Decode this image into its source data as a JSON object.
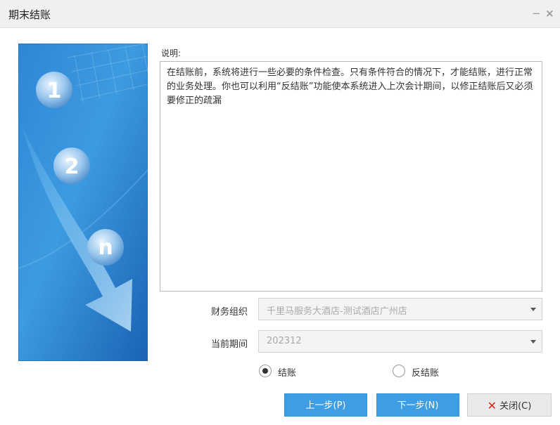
{
  "window": {
    "title": "期末结账",
    "minimize_glyph": "−",
    "close_glyph": "×"
  },
  "wizard_graphic": {
    "step_labels": [
      "1",
      "2",
      "n"
    ],
    "icon": "wizard-steps-illustration",
    "colors": {
      "blue_dark": "#1f6fbf",
      "blue_light": "#4aa6e2"
    }
  },
  "description": {
    "label": "说明:",
    "text": "在结账前，系统将进行一些必要的条件检查。只有条件符合的情况下，才能结账，进行正常的业务处理。你也可以利用“反结账”功能使本系统进入上次会计期间，以修正结账后又必须要修正的疏漏"
  },
  "fields": {
    "org_label": "财务组织",
    "org_value": "千里马服务大酒店-测试酒店广州店",
    "period_label": "当前期间",
    "period_value": "202312"
  },
  "mode": {
    "options": [
      {
        "label": "结账",
        "selected": true
      },
      {
        "label": "反结账",
        "selected": false
      }
    ]
  },
  "buttons": {
    "prev": "上一步(P)",
    "next": "下一步(N)",
    "close": "关闭(C)",
    "close_icon": "x-icon"
  },
  "colors": {
    "accent": "#3d9ee6",
    "close_x": "#dd2222",
    "titlebar": "#f0f0f0"
  }
}
